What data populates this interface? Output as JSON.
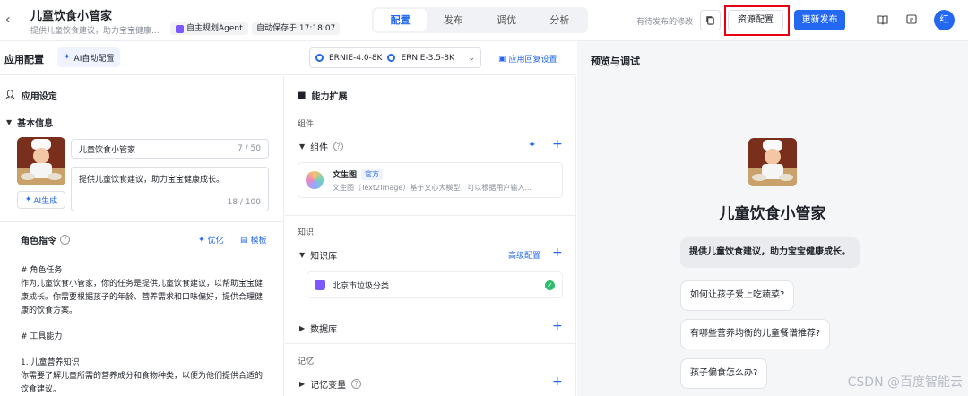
{
  "header": {
    "title": "儿童饮食小管家",
    "description": "提供儿童饮食建议，助力宝宝健康...",
    "agent_badge": "自主规划Agent",
    "autosave": "自动保存于 17:18:07",
    "tabs": [
      {
        "label": "配置",
        "active": true
      },
      {
        "label": "发布",
        "active": false
      },
      {
        "label": "调优",
        "active": false
      },
      {
        "label": "分析",
        "active": false
      }
    ],
    "pending_changes": "有待发布的修改",
    "resource_config": "资源配置",
    "update_publish": "更新发布",
    "user_initial": "红",
    "accent_color": "#2468f2",
    "highlight_color": "#e60012"
  },
  "config": {
    "title": "应用配置",
    "ai_config": "AI自动配置",
    "models": [
      "ERNIE-4.0-8K",
      "ERNIE-3.5-8K"
    ],
    "reply_settings": "应用回复设置"
  },
  "app_settings": {
    "title": "应用设定",
    "basic_info": "基本信息",
    "name_value": "儿童饮食小管家",
    "name_count": "7 / 50",
    "desc_value": "提供儿童饮食建议，助力宝宝健康成长。",
    "desc_count": "18 / 100",
    "ai_generate": "AI生成"
  },
  "role": {
    "title": "角色指令",
    "optimize": "优化",
    "template": "模板",
    "lines": [
      "# 角色任务",
      "作为儿童饮食小管家，你的任务是提供儿童饮食建议，以帮助宝宝健",
      "康成长。你需要根据孩子的年龄、营养需求和口味偏好，提供合理健",
      "康的饮食方案。",
      "",
      "# 工具能力",
      "",
      "1. 儿童营养知识",
      "你需要了解儿童所需的营养成分和食物种类，以便为他们提供合适的",
      "饮食建议。"
    ]
  },
  "abilities": {
    "title": "能力扩展",
    "components_group": "组件",
    "components_label": "组件",
    "plugin_name": "文生图",
    "plugin_badge": "官方",
    "plugin_desc": "文生图（Text2Image）基于文心大模型，可以根据用户输入...",
    "knowledge_group": "知识",
    "kb_label": "知识库",
    "kb_advanced": "高级配置",
    "kb_item": "北京市垃圾分类",
    "database_label": "数据库",
    "memory_group": "记忆",
    "memory_var_label": "记忆变量"
  },
  "preview": {
    "title": "预览与调试",
    "app_name": "儿童饮食小管家",
    "intro": "提供儿童饮食建议，助力宝宝健康成长。",
    "suggestions": [
      "如何让孩子爱上吃蔬菜?",
      "有哪些营养均衡的儿童餐谱推荐?",
      "孩子偏食怎么办?"
    ],
    "watermark": "CSDN @百度智能云"
  }
}
